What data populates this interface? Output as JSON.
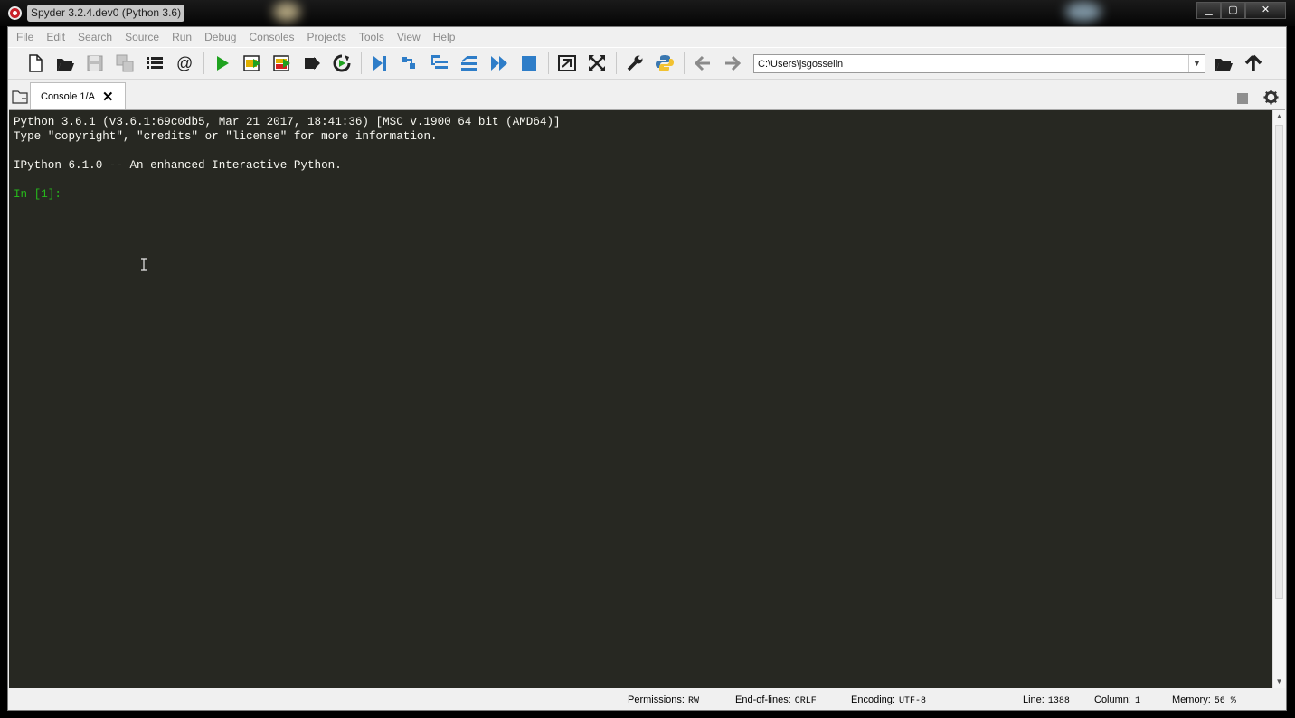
{
  "window": {
    "title": "Spyder 3.2.4.dev0 (Python 3.6)",
    "minimize_icon": "minimize-icon",
    "maximize_icon": "maximize-icon",
    "close_icon": "close-icon"
  },
  "menubar": {
    "items": [
      "File",
      "Edit",
      "Search",
      "Source",
      "Run",
      "Debug",
      "Consoles",
      "Projects",
      "Tools",
      "View",
      "Help"
    ]
  },
  "toolbar": {
    "icons": [
      "new-file-icon",
      "open-file-icon",
      "save-icon",
      "save-all-icon",
      "outline-icon",
      "at-icon",
      "run-icon",
      "run-cell-icon",
      "run-cell-advance-icon",
      "run-selection-icon",
      "rerun-icon",
      "debug-icon",
      "step-icon",
      "step-into-icon",
      "step-return-icon",
      "continue-icon",
      "stop-debug-icon",
      "maximize-pane-icon",
      "fullscreen-icon",
      "preferences-icon",
      "python-path-icon",
      "back-icon",
      "forward-icon",
      "browse-folder-icon",
      "parent-dir-icon"
    ],
    "working_dir": "C:\\Users\\jsgosselin"
  },
  "tabs": {
    "active_label": "Console 1/A",
    "close_glyph": "✕"
  },
  "console": {
    "line1": "Python 3.6.1 (v3.6.1:69c0db5, Mar 21 2017, 18:41:36) [MSC v.1900 64 bit (AMD64)]",
    "line2": "Type \"copyright\", \"credits\" or \"license\" for more information.",
    "line3": "",
    "line4": "IPython 6.1.0 -- An enhanced Interactive Python.",
    "line5": "",
    "prompt": "In [1]:"
  },
  "statusbar": {
    "permissions_label": "Permissions:",
    "permissions_value": "RW",
    "eol_label": "End-of-lines:",
    "eol_value": "CRLF",
    "encoding_label": "Encoding:",
    "encoding_value": "UTF-8",
    "line_label": "Line:",
    "line_value": "1388",
    "column_label": "Column:",
    "column_value": "1",
    "memory_label": "Memory:",
    "memory_value": "56 %"
  },
  "colors": {
    "console_bg": "#272822",
    "console_fg": "#f8f8f2",
    "prompt": "#26b81b",
    "run_green": "#1fa21f",
    "debug_blue": "#2e7dc8"
  }
}
